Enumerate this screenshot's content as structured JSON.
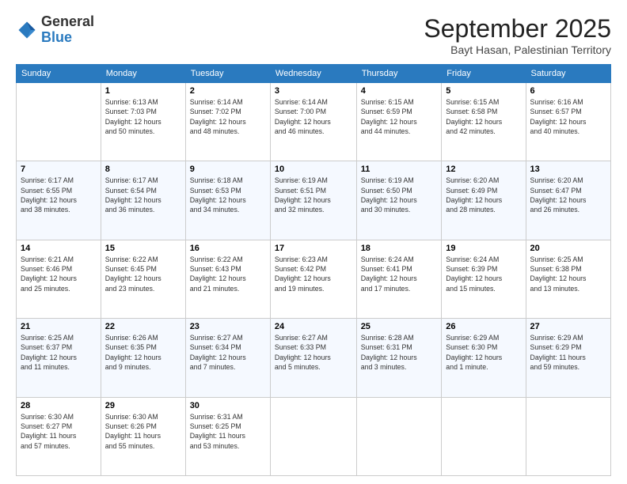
{
  "header": {
    "logo": {
      "general": "General",
      "blue": "Blue"
    },
    "title": "September 2025",
    "subtitle": "Bayt Hasan, Palestinian Territory"
  },
  "days_of_week": [
    "Sunday",
    "Monday",
    "Tuesday",
    "Wednesday",
    "Thursday",
    "Friday",
    "Saturday"
  ],
  "weeks": [
    [
      {
        "day": "",
        "info": ""
      },
      {
        "day": "1",
        "info": "Sunrise: 6:13 AM\nSunset: 7:03 PM\nDaylight: 12 hours\nand 50 minutes."
      },
      {
        "day": "2",
        "info": "Sunrise: 6:14 AM\nSunset: 7:02 PM\nDaylight: 12 hours\nand 48 minutes."
      },
      {
        "day": "3",
        "info": "Sunrise: 6:14 AM\nSunset: 7:00 PM\nDaylight: 12 hours\nand 46 minutes."
      },
      {
        "day": "4",
        "info": "Sunrise: 6:15 AM\nSunset: 6:59 PM\nDaylight: 12 hours\nand 44 minutes."
      },
      {
        "day": "5",
        "info": "Sunrise: 6:15 AM\nSunset: 6:58 PM\nDaylight: 12 hours\nand 42 minutes."
      },
      {
        "day": "6",
        "info": "Sunrise: 6:16 AM\nSunset: 6:57 PM\nDaylight: 12 hours\nand 40 minutes."
      }
    ],
    [
      {
        "day": "7",
        "info": "Sunrise: 6:17 AM\nSunset: 6:55 PM\nDaylight: 12 hours\nand 38 minutes."
      },
      {
        "day": "8",
        "info": "Sunrise: 6:17 AM\nSunset: 6:54 PM\nDaylight: 12 hours\nand 36 minutes."
      },
      {
        "day": "9",
        "info": "Sunrise: 6:18 AM\nSunset: 6:53 PM\nDaylight: 12 hours\nand 34 minutes."
      },
      {
        "day": "10",
        "info": "Sunrise: 6:19 AM\nSunset: 6:51 PM\nDaylight: 12 hours\nand 32 minutes."
      },
      {
        "day": "11",
        "info": "Sunrise: 6:19 AM\nSunset: 6:50 PM\nDaylight: 12 hours\nand 30 minutes."
      },
      {
        "day": "12",
        "info": "Sunrise: 6:20 AM\nSunset: 6:49 PM\nDaylight: 12 hours\nand 28 minutes."
      },
      {
        "day": "13",
        "info": "Sunrise: 6:20 AM\nSunset: 6:47 PM\nDaylight: 12 hours\nand 26 minutes."
      }
    ],
    [
      {
        "day": "14",
        "info": "Sunrise: 6:21 AM\nSunset: 6:46 PM\nDaylight: 12 hours\nand 25 minutes."
      },
      {
        "day": "15",
        "info": "Sunrise: 6:22 AM\nSunset: 6:45 PM\nDaylight: 12 hours\nand 23 minutes."
      },
      {
        "day": "16",
        "info": "Sunrise: 6:22 AM\nSunset: 6:43 PM\nDaylight: 12 hours\nand 21 minutes."
      },
      {
        "day": "17",
        "info": "Sunrise: 6:23 AM\nSunset: 6:42 PM\nDaylight: 12 hours\nand 19 minutes."
      },
      {
        "day": "18",
        "info": "Sunrise: 6:24 AM\nSunset: 6:41 PM\nDaylight: 12 hours\nand 17 minutes."
      },
      {
        "day": "19",
        "info": "Sunrise: 6:24 AM\nSunset: 6:39 PM\nDaylight: 12 hours\nand 15 minutes."
      },
      {
        "day": "20",
        "info": "Sunrise: 6:25 AM\nSunset: 6:38 PM\nDaylight: 12 hours\nand 13 minutes."
      }
    ],
    [
      {
        "day": "21",
        "info": "Sunrise: 6:25 AM\nSunset: 6:37 PM\nDaylight: 12 hours\nand 11 minutes."
      },
      {
        "day": "22",
        "info": "Sunrise: 6:26 AM\nSunset: 6:35 PM\nDaylight: 12 hours\nand 9 minutes."
      },
      {
        "day": "23",
        "info": "Sunrise: 6:27 AM\nSunset: 6:34 PM\nDaylight: 12 hours\nand 7 minutes."
      },
      {
        "day": "24",
        "info": "Sunrise: 6:27 AM\nSunset: 6:33 PM\nDaylight: 12 hours\nand 5 minutes."
      },
      {
        "day": "25",
        "info": "Sunrise: 6:28 AM\nSunset: 6:31 PM\nDaylight: 12 hours\nand 3 minutes."
      },
      {
        "day": "26",
        "info": "Sunrise: 6:29 AM\nSunset: 6:30 PM\nDaylight: 12 hours\nand 1 minute."
      },
      {
        "day": "27",
        "info": "Sunrise: 6:29 AM\nSunset: 6:29 PM\nDaylight: 11 hours\nand 59 minutes."
      }
    ],
    [
      {
        "day": "28",
        "info": "Sunrise: 6:30 AM\nSunset: 6:27 PM\nDaylight: 11 hours\nand 57 minutes."
      },
      {
        "day": "29",
        "info": "Sunrise: 6:30 AM\nSunset: 6:26 PM\nDaylight: 11 hours\nand 55 minutes."
      },
      {
        "day": "30",
        "info": "Sunrise: 6:31 AM\nSunset: 6:25 PM\nDaylight: 11 hours\nand 53 minutes."
      },
      {
        "day": "",
        "info": ""
      },
      {
        "day": "",
        "info": ""
      },
      {
        "day": "",
        "info": ""
      },
      {
        "day": "",
        "info": ""
      }
    ]
  ]
}
